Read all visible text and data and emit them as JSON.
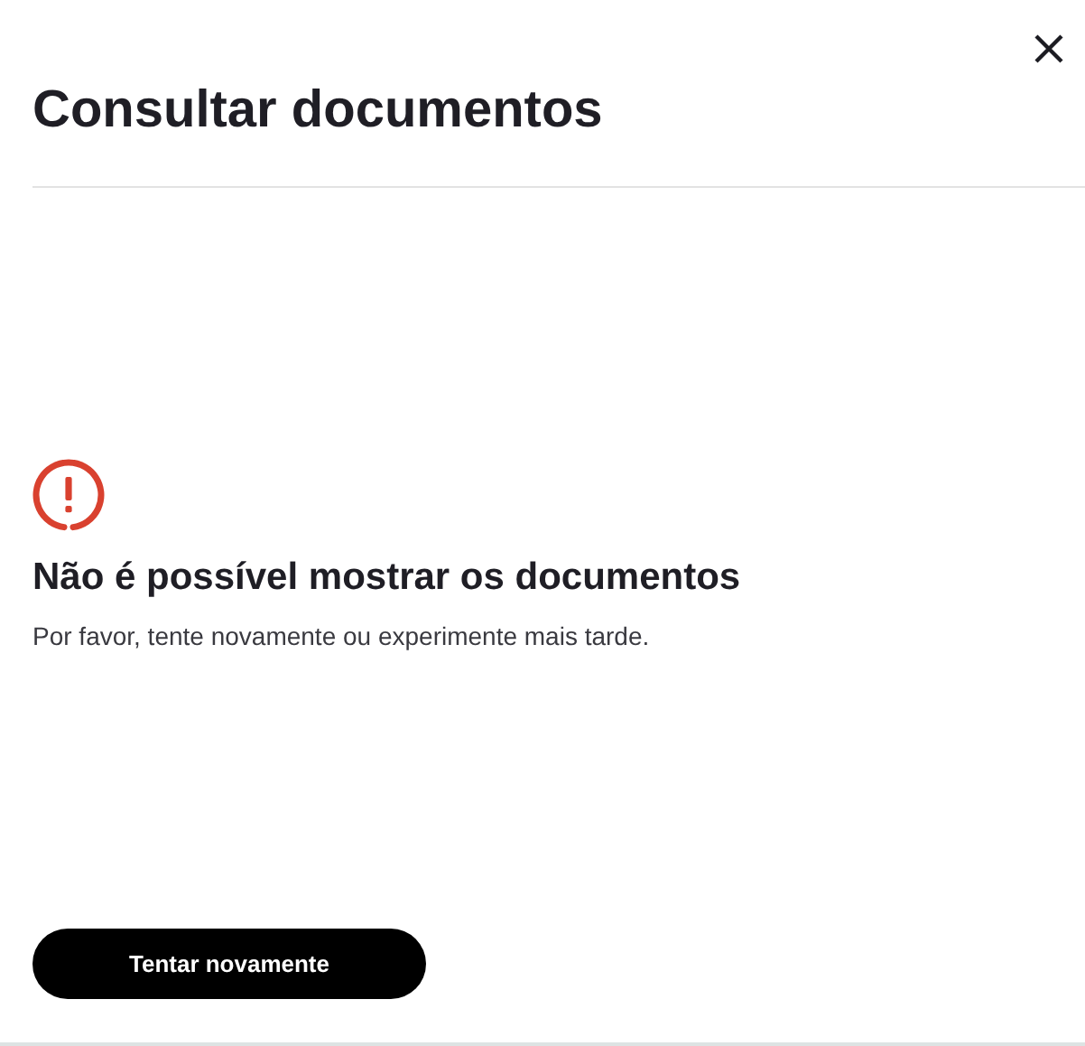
{
  "dialog": {
    "title": "Consultar documentos"
  },
  "error": {
    "title": "Não é possível mostrar os documentos",
    "message": "Por favor, tente novamente ou experimente mais tarde."
  },
  "buttons": [
    "Tentar novamente"
  ]
}
